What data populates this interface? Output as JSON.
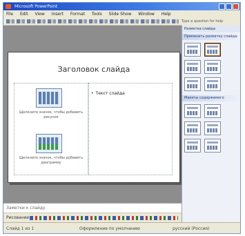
{
  "window": {
    "title": "Microsoft PowerPoint"
  },
  "menubar": {
    "items": [
      "File",
      "Edit",
      "View",
      "Insert",
      "Format",
      "Tools",
      "Slide Show",
      "Window",
      "Help"
    ]
  },
  "toolbar": {
    "font_hint": "Type a question for help"
  },
  "slide": {
    "title": "Заголовок слайда",
    "left_top_caption": "Щелкните значок, чтобы добавить рисунок",
    "left_bottom_caption": "Щелкните значок, чтобы добавить диаграмму",
    "bullet_text": "Текст слайда"
  },
  "notes": {
    "text": "Заметки к слайду"
  },
  "drawbar": {
    "label": "Рисование"
  },
  "statusbar": {
    "slide_info": "Слайд 1 из 1",
    "design": "Оформление по умолчанию",
    "language": "русский (Россия)"
  },
  "task_pane": {
    "title": "Разметка слайда",
    "section_apply": "Применить разметку слайда:",
    "section_content": "Макеты содержимого"
  },
  "colors": {
    "titlebar": "#1b48c5",
    "workspace": "#8d8d8d",
    "selection": "#d07a27"
  }
}
